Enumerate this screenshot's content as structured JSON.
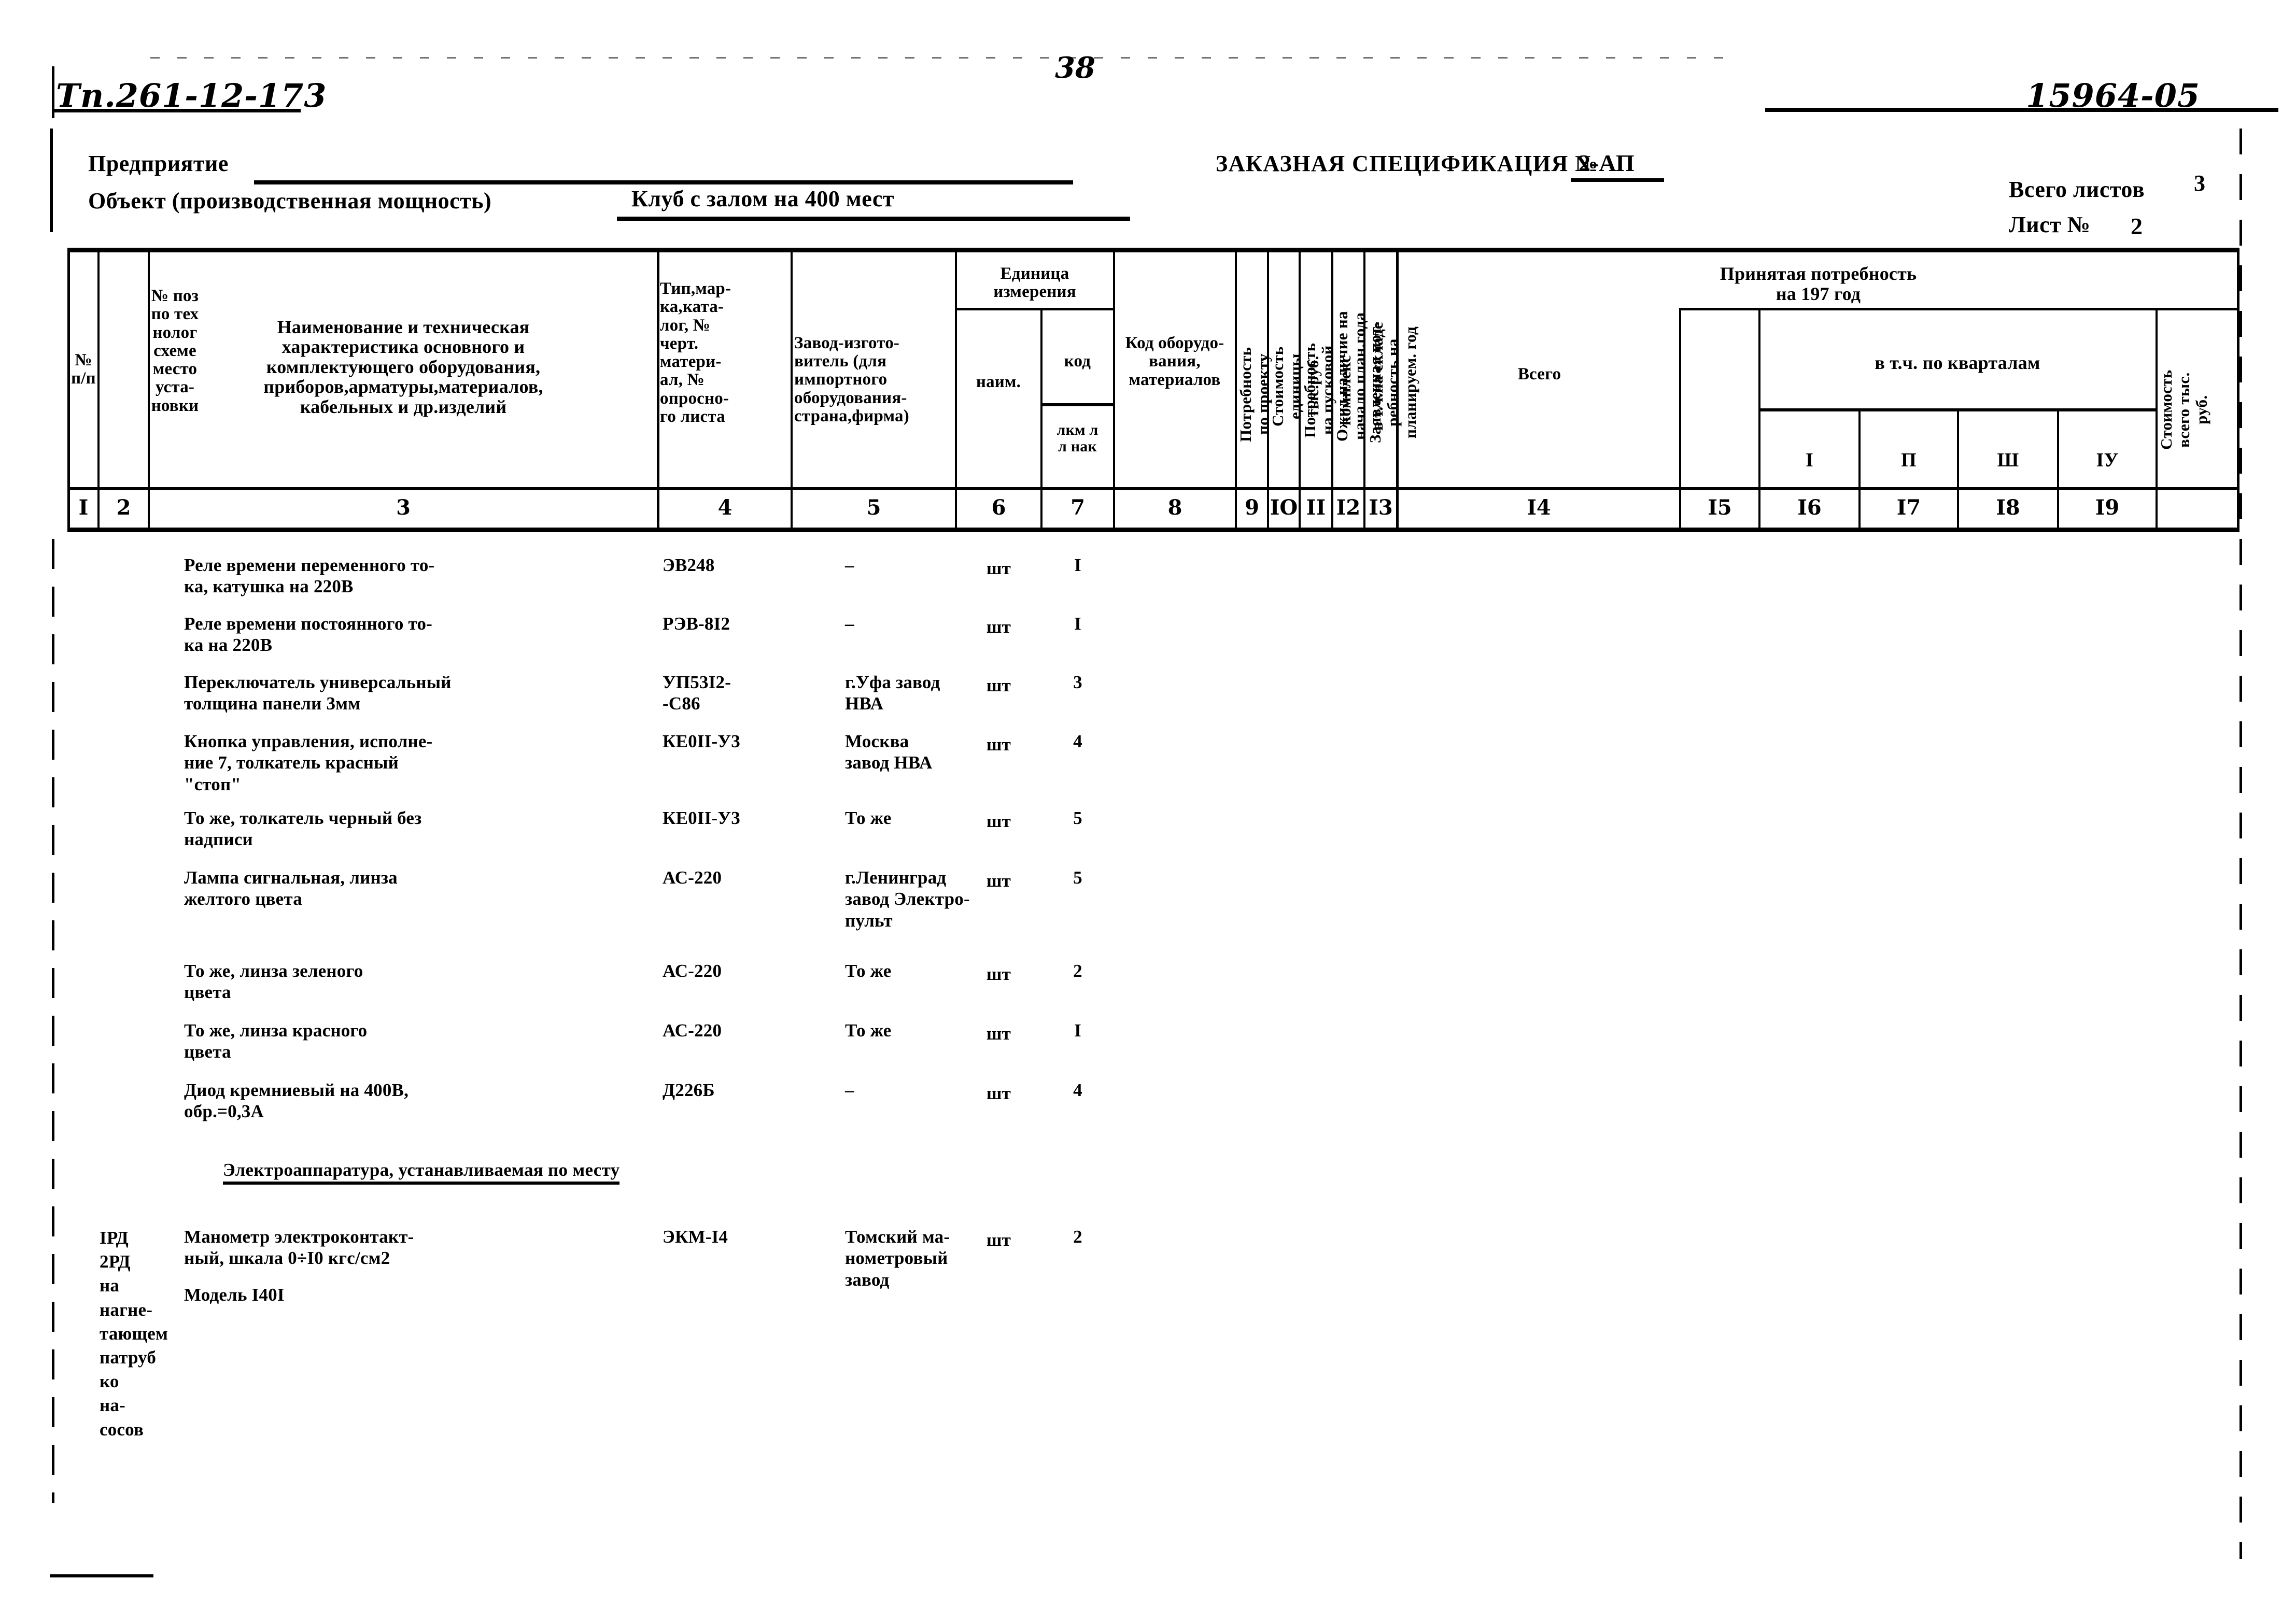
{
  "page": {
    "stamp_left": "Тп.261-12-173",
    "page_number": "38",
    "stamp_right": "15964-05"
  },
  "header": {
    "enterprise_label": "Предприятие",
    "enterprise_value": "",
    "object_label": "Объект (производственная мощность)",
    "object_value": "Клуб с залом на 400 мест",
    "spec_title": "ЗАКАЗНАЯ СПЕЦИФИКАЦИЯ №",
    "spec_number": "2-АП",
    "total_sheets_label": "Всего листов",
    "total_sheets_value": "3",
    "sheet_label": "Лист №",
    "sheet_value": "2"
  },
  "table": {
    "columns": {
      "c1": "№\nп/п",
      "c2": "№ поз\nпо тех\nнолог\nсхеме\nместо\nуста-\nновки",
      "c3": "Наименование и техническая\nхарактеристика основного и\nкомплектующего оборудования,\nприборов,арматуры,материалов,\nкабельных и др.изделий",
      "c4": "Тип,мар-\nка,ката-\nлог, №\nчерт.\nматери-\nал, №\nопросно-\nго листа",
      "c5": "Завод-изгото-\nвитель (для\nимпортного\nоборудования-\nстрана,фирма)",
      "unit_group": "Единица\nизмерения",
      "c6": "наим.",
      "c7_top": "код",
      "c7_bottom": "лкм л\nл нак",
      "c8": "Код оборудо-\nвания,\nматериалов",
      "c9": "Потребность\nпо проекту",
      "c10": "Стоимость\nединицы\nтыс.руб.",
      "c11": "Потребность\nна пусковой\nкомплекс",
      "c12": "Ожид.наличие на\nначало план.года\nв т.ч.на складе",
      "c13": "Заявленная пот-\nребность на\nпланируем. год",
      "accepted_group": "Принятая потребность\nна 197      год",
      "c14": "Всего",
      "quarters_group": "в т.ч. по кварталам",
      "c15": "I",
      "c16": "П",
      "c17": "Ш",
      "c18": "IУ",
      "c19": "Стоимость\nвсего тыс.\nруб."
    },
    "column_numbers": [
      "I",
      "2",
      "3",
      "4",
      "5",
      "6",
      "7",
      "8",
      "9",
      "IO",
      "II",
      "I2",
      "I3",
      "I4",
      "I5",
      "I6",
      "I7",
      "I8",
      "I9"
    ],
    "rows": [
      {
        "pos": "",
        "name": "Реле времени переменного то-\nка, катушка на 220В",
        "type": "ЭВ248",
        "factory": "–",
        "unit": "шт",
        "code": "I"
      },
      {
        "pos": "",
        "name": "Реле времени постоянного то-\nка на 220В",
        "type": "РЭВ-8I2",
        "factory": "–",
        "unit": "шт",
        "code": "I"
      },
      {
        "pos": "",
        "name": "Переключатель универсальный\nтолщина панели 3мм",
        "type": "УП53I2-\n-С86",
        "factory": "г.Уфа завод\nНВА",
        "unit": "шт",
        "code": "3"
      },
      {
        "pos": "",
        "name": "Кнопка управления, исполне-\nние 7, толкатель красный\n\"стоп\"",
        "type": "КЕ0II-У3",
        "factory": "Москва\nзавод НВА",
        "unit": "шт",
        "code": "4"
      },
      {
        "pos": "",
        "name": "То же, толкатель черный без\nнадписи",
        "type": "КЕ0II-У3",
        "factory": "То же",
        "unit": "шт",
        "code": "5"
      },
      {
        "pos": "",
        "name": "Лампа сигнальная, линза\nжелтого цвета",
        "type": "АС-220",
        "factory": "г.Ленинград\nзавод Электро-\nпульт",
        "unit": "шт",
        "code": "5"
      },
      {
        "pos": "",
        "name": "То же, линза зеленого\nцвета",
        "type": "АС-220",
        "factory": "То же",
        "unit": "шт",
        "code": "2"
      },
      {
        "pos": "",
        "name": "То же, линза красного\nцвета",
        "type": "АС-220",
        "factory": "То же",
        "unit": "шт",
        "code": "I"
      },
      {
        "pos": "",
        "name": "Диод кремниевый на 400В,\n  обр.=0,3А",
        "type": "Д226Б",
        "factory": "–",
        "unit": "шт",
        "code": "4"
      }
    ],
    "section_heading": "Электроаппаратура, устанавливаемая по месту",
    "last_row": {
      "pos": "IРД\n2РД на\nнагне-\nтающем\nпатруб\nко на-\nсосов",
      "name": "Манометр электроконтакт-\nный, шкала 0÷I0 кгс/см2",
      "name2": "Модель I40I",
      "type": "ЭКМ-I4",
      "factory": "Томский ма-\nнометровый\nзавод",
      "unit": "шт",
      "code": "2"
    }
  }
}
